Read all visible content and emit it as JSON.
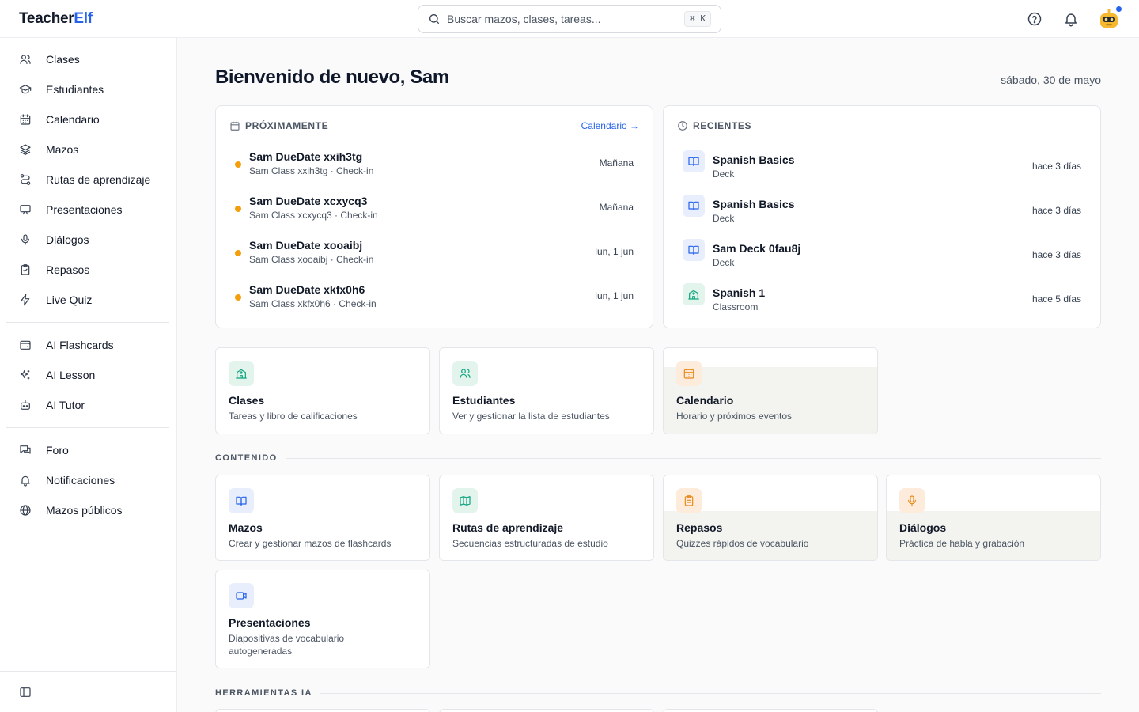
{
  "app": {
    "logo_part1": "Teacher",
    "logo_part2": "Elf"
  },
  "search": {
    "placeholder": "Buscar mazos, clases, tareas...",
    "shortcut": "⌘ K"
  },
  "sidebar": {
    "items": [
      {
        "label": "Clases",
        "icon": "users-icon"
      },
      {
        "label": "Estudiantes",
        "icon": "graduation-cap-icon"
      },
      {
        "label": "Calendario",
        "icon": "calendar-icon"
      },
      {
        "label": "Mazos",
        "icon": "layers-icon"
      },
      {
        "label": "Rutas de aprendizaje",
        "icon": "route-icon"
      },
      {
        "label": "Presentaciones",
        "icon": "presentation-icon"
      },
      {
        "label": "Diálogos",
        "icon": "microphone-icon"
      },
      {
        "label": "Repasos",
        "icon": "clipboard-check-icon"
      },
      {
        "label": "Live Quiz",
        "icon": "lightning-icon"
      }
    ],
    "ai_items": [
      {
        "label": "AI Flashcards",
        "icon": "wallet-cards-icon"
      },
      {
        "label": "AI Lesson",
        "icon": "sparkles-icon"
      },
      {
        "label": "AI Tutor",
        "icon": "bot-icon"
      }
    ],
    "community_items": [
      {
        "label": "Foro",
        "icon": "chat-icon"
      },
      {
        "label": "Notificaciones",
        "icon": "bell-icon"
      },
      {
        "label": "Mazos públicos",
        "icon": "globe-icon"
      }
    ]
  },
  "main": {
    "greeting": "Bienvenido de nuevo, Sam",
    "date": "sábado, 30 de mayo",
    "upcoming": {
      "title": "PRÓXIMAMENTE",
      "link": "Calendario →",
      "items": [
        {
          "title": "Sam DueDate xxih3tg",
          "subtitle": "Sam Class xxih3tg · Check-in",
          "when": "Mañana"
        },
        {
          "title": "Sam DueDate xcxycq3",
          "subtitle": "Sam Class xcxycq3 · Check-in",
          "when": "Mañana"
        },
        {
          "title": "Sam DueDate xooaibj",
          "subtitle": "Sam Class xooaibj · Check-in",
          "when": "lun, 1 jun"
        },
        {
          "title": "Sam DueDate xkfx0h6",
          "subtitle": "Sam Class xkfx0h6 · Check-in",
          "when": "lun, 1 jun"
        }
      ]
    },
    "recent": {
      "title": "RECIENTES",
      "items": [
        {
          "title": "Spanish Basics",
          "subtitle": "Deck",
          "when": "hace 3 días",
          "icon": "book-icon"
        },
        {
          "title": "Spanish Basics",
          "subtitle": "Deck",
          "when": "hace 3 días",
          "icon": "book-icon"
        },
        {
          "title": "Sam Deck 0fau8j",
          "subtitle": "Deck",
          "when": "hace 3 días",
          "icon": "book-icon"
        },
        {
          "title": "Spanish 1",
          "subtitle": "Classroom",
          "when": "hace 5 días",
          "icon": "school-icon"
        }
      ]
    },
    "quick_cards": [
      {
        "title": "Clases",
        "desc": "Tareas y libro de calificaciones",
        "icon": "school-icon"
      },
      {
        "title": "Estudiantes",
        "desc": "Ver y gestionar la lista de estudiantes",
        "icon": "users-icon"
      },
      {
        "title": "Calendario",
        "desc": "Horario y próximos eventos",
        "icon": "calendar-icon"
      }
    ],
    "content_section": "CONTENIDO",
    "content_cards": [
      {
        "title": "Mazos",
        "desc": "Crear y gestionar mazos de flashcards",
        "icon": "book-icon"
      },
      {
        "title": "Rutas de aprendizaje",
        "desc": "Secuencias estructuradas de estudio",
        "icon": "map-icon"
      },
      {
        "title": "Repasos",
        "desc": "Quizzes rápidos de vocabulario",
        "icon": "clipboard-icon"
      },
      {
        "title": "Diálogos",
        "desc": "Práctica de habla y grabación",
        "icon": "microphone-icon"
      },
      {
        "title": "Presentaciones",
        "desc": "Diapositivas de vocabulario autogeneradas",
        "icon": "video-icon"
      }
    ],
    "ai_section": "HERRAMIENTAS IA"
  },
  "colors": {
    "accent": "#2563eb",
    "warning_dot": "#f59e0b",
    "green_icon": "#10a37f",
    "orange_icon": "#ea8a1a"
  }
}
